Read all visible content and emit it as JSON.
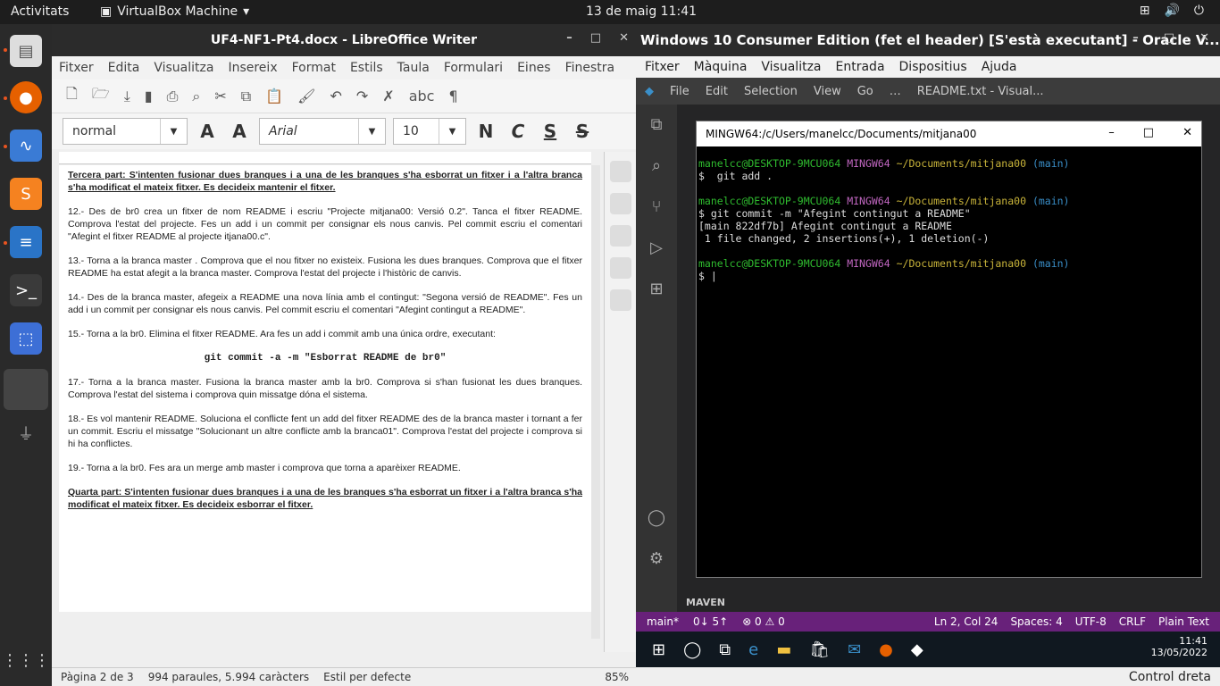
{
  "topbar": {
    "activities": "Activitats",
    "app": "VirtualBox Machine",
    "clock": "13 de maig  11:41"
  },
  "writer": {
    "title": "UF4-NF1-Pt4.docx - LibreOffice Writer",
    "menu": [
      "Fitxer",
      "Edita",
      "Visualitza",
      "Insereix",
      "Format",
      "Estils",
      "Taula",
      "Formulari",
      "Eines",
      "Finestra"
    ],
    "style": "normal",
    "font": "Arial",
    "size": "10",
    "bold": "N",
    "italic": "C",
    "underline": "S",
    "strike": "S",
    "paragraphs": [
      "Tercera part:  S'intenten fusionar dues branques i a una de les branques s'ha esborrat un fitxer i a l'altra branca s'ha modificat el mateix fitxer. Es decideix mantenir el fitxer.",
      "12.- Des de br0 crea un fitxer de nom README i escriu \"Projecte mitjana00: Versió 0.2\". Tanca el fitxer README. Comprova l'estat del projecte. Fes un add i un commit per consignar els nous canvis. Pel commit escriu el comentari \"Afegint el fitxer README al projecte itjana00.c\".",
      "13.- Torna a la branca master . Comprova que el nou fitxer no existeix. Fusiona les dues branques. Comprova que el fitxer README ha estat afegit a la branca master. Comprova l'estat del projecte i l'històric de canvis.",
      "14.- Des de la branca master, afegeix a README una nova línia amb el contingut: \"Segona versió de README\". Fes un add i un commit per consignar els nous canvis. Pel commit escriu el comentari \"Afegint contingut a README\".",
      "15.- Torna a la br0. Elimina el fitxer README. Ara fes un add i commit amb una única ordre, executant:"
    ],
    "code": "git commit -a -m \"Esborrat README de br0\"",
    "paragraphs2": [
      "17.- Torna a la branca master. Fusiona la branca master amb la br0. Comprova si s'han fusionat les dues branques. Comprova l'estat del sistema i comprova quin missatge dóna el sistema.",
      "18.- Es vol mantenir README. Soluciona el conflicte fent un add del fitxer README des de la branca master i tornant a fer un commit. Escriu el missatge \"Solucionant un altre conflicte amb la branca01\". Comprova l'estat del projecte i comprova si hi ha conflictes.",
      "19.- Torna a la br0. Fes ara un merge amb master i comprova que torna a aparèixer README.",
      "Quarta part: S'intenten fusionar dues branques i a una de les branques s'ha esborrat un fitxer i a l'altra branca s'ha modificat el mateix fitxer. Es decideix esborrar el fitxer."
    ],
    "status": {
      "page": "Pàgina 2 de 3",
      "words": "994 paraules, 5.994 caràcters",
      "style": "Estil per defecte",
      "zoom": "85%"
    }
  },
  "vbox": {
    "title": "Windows 10 Consumer Edition (fet el header) [S'està executant] - Oracle V...",
    "menu": [
      "Fitxer",
      "Màquina",
      "Visualitza",
      "Entrada",
      "Dispositius",
      "Ajuda"
    ],
    "vscode": {
      "menu": [
        "File",
        "Edit",
        "Selection",
        "View",
        "Go",
        "…"
      ],
      "title": "README.txt - Visual...",
      "maven": "MAVEN",
      "status_left": [
        "main*",
        "0↓ 5↑",
        "⊗ 0 ⚠ 0"
      ],
      "status_right": [
        "Ln 2, Col 24",
        "Spaces: 4",
        "UTF-8",
        "CRLF",
        "Plain Text"
      ]
    },
    "terminal": {
      "title": "MINGW64:/c/Users/manelcc/Documents/mitjana00",
      "user": "manelcc@DESKTOP-9MCU064",
      "shell": "MINGW64",
      "path": "~/Documents/mitjana00",
      "branch": "(main)",
      "cmd1": "$  git add .",
      "cmd2": "$ git commit -m \"Afegint contingut a README\"",
      "out1": "[main 822df7b] Afegint contingut a README",
      "out2": " 1 file changed, 2 insertions(+), 1 deletion(-)",
      "prompt": "$ |"
    },
    "taskbar_time": "11:41",
    "taskbar_date": "13/05/2022",
    "host_key": "Control dreta"
  }
}
